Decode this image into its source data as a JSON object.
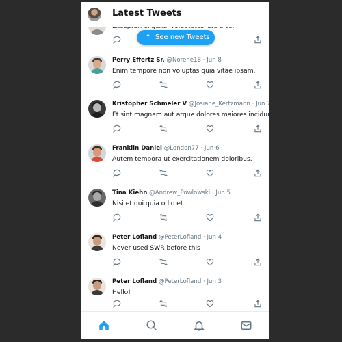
{
  "header": {
    "title": "Latest Tweets"
  },
  "new_tweets_button": {
    "arrow": "↑",
    "label": "See new Tweets"
  },
  "partial_tweet": {
    "text": "Excepturi eligendi voluptates iste eius."
  },
  "tweets": [
    {
      "name": "Perry Effertz Sr.",
      "handle": "@Norene18",
      "date": "· Jun 8",
      "text": "Enim tempore non voluptas quia vitae ipsam."
    },
    {
      "name": "Kristopher Schmeler V",
      "handle": "@Josiane_Kertzmann",
      "date": "· Jun 7",
      "text": "Et sint magnam aut atque dolores maiores incidunt."
    },
    {
      "name": "Franklin Daniel",
      "handle": "@London77",
      "date": "· Jun 6",
      "text": "Autem tempora ut exercitationem doloribus."
    },
    {
      "name": "Tina Kiehn",
      "handle": "@Andrew_Powlowski",
      "date": "· Jun 5",
      "text": "Nisi et qui quia odio et."
    },
    {
      "name": "Peter Lofland",
      "handle": "@PeterLofland",
      "date": "· Jun 4",
      "text": "Never used SWR before this"
    },
    {
      "name": "Peter Lofland",
      "handle": "@PeterLofland",
      "date": "· Jun 3",
      "text": "Hello!"
    }
  ],
  "icons": {
    "reply": "reply-icon",
    "retweet": "retweet-icon",
    "like": "like-icon",
    "share": "share-icon",
    "nav": [
      "home-icon",
      "search-icon",
      "notifications-icon",
      "messages-icon"
    ]
  },
  "colors": {
    "accent": "#1da1f2",
    "text": "#14171a",
    "muted": "#657786",
    "border": "#e6ecf0"
  }
}
